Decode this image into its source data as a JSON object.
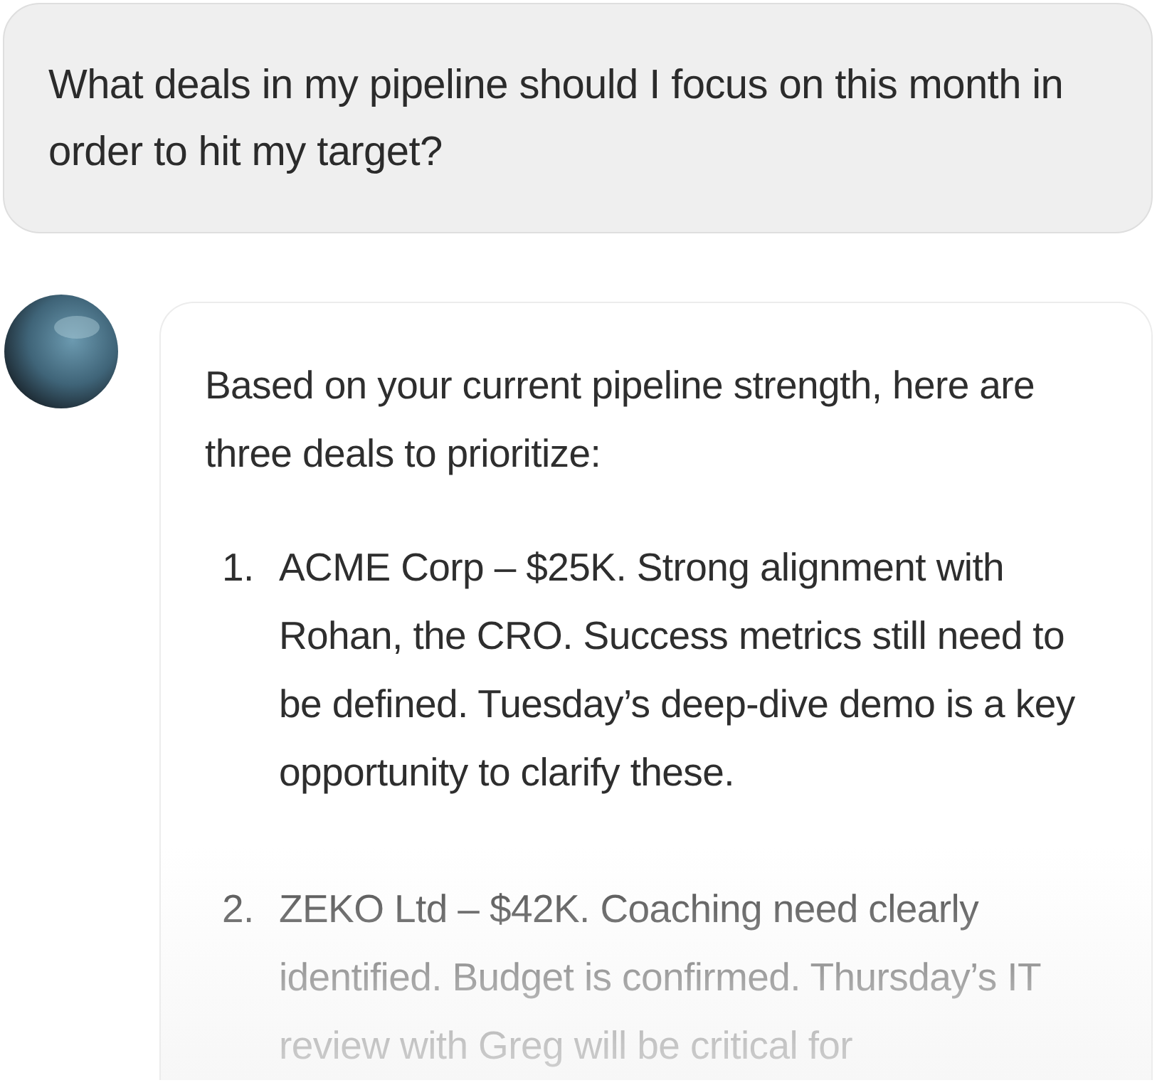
{
  "user_message": {
    "text": "What deals in my pipeline should I focus on this month in order to hit my target?"
  },
  "assistant_message": {
    "intro": "Based on your current pipeline strength, here are three deals to prioritize:",
    "items": [
      {
        "number": "1.",
        "text": "ACME Corp – $25K. Strong alignment with Rohan, the CRO. Success metrics still need to be defined. Tuesday’s deep-dive demo is a key opportunity to clarify these."
      },
      {
        "number": "2.",
        "text": "ZEKO Ltd – $42K. Coaching need clearly identified. Budget is confirmed. Thursday’s IT review with Greg will be critical for"
      }
    ]
  }
}
